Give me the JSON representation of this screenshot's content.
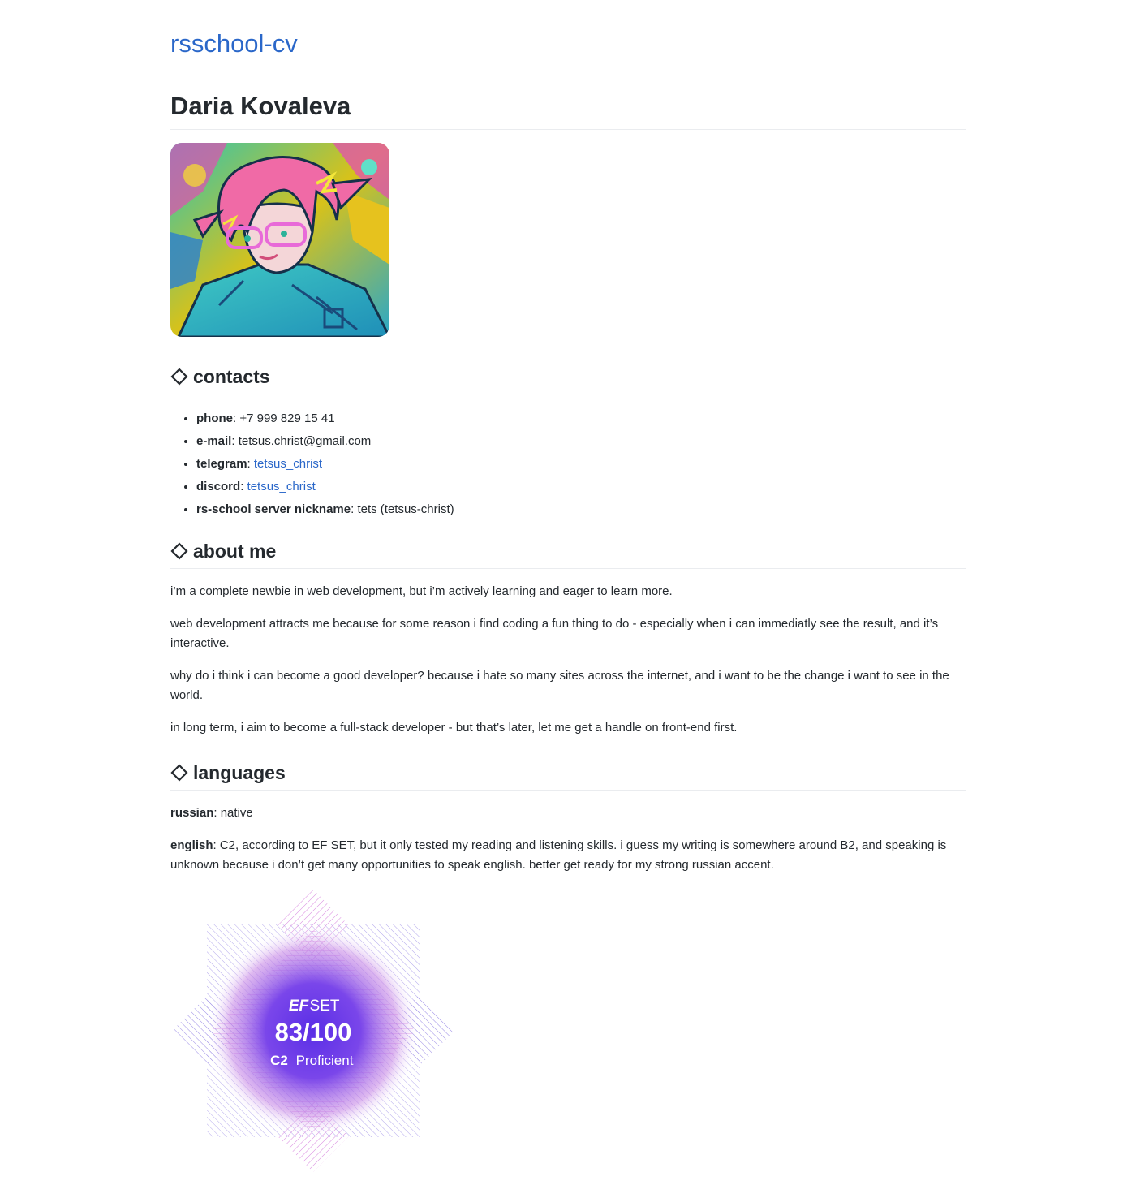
{
  "site": {
    "title": "rsschool-cv"
  },
  "profile": {
    "name": "Daria Kovaleva"
  },
  "contacts": {
    "heading": "contacts",
    "items": [
      {
        "label": "phone",
        "sep": ": ",
        "value": "+7 999 829 15 41",
        "is_link": false
      },
      {
        "label": "e-mail",
        "sep": ": ",
        "value": "tetsus.christ@gmail.com",
        "is_link": false
      },
      {
        "label": "telegram",
        "sep": ": ",
        "value": "tetsus_christ",
        "is_link": true
      },
      {
        "label": "discord",
        "sep": ": ",
        "value": "tetsus_christ",
        "is_link": true
      },
      {
        "label": "rs-school server nickname",
        "sep": ": ",
        "value": "tets (tetsus-christ)",
        "is_link": false
      }
    ]
  },
  "about": {
    "heading": "about me",
    "paragraphs": [
      "i’m a complete newbie in web development, but i’m actively learning and eager to learn more.",
      "web development attracts me because for some reason i find coding a fun thing to do - especially when i can immediatly see the result, and it’s interactive.",
      "why do i think i can become a good developer? because i hate so many sites across the internet, and i want to be the change i want to see in the world.",
      "in long term, i aim to become a full-stack developer - but that’s later, let me get a handle on front-end first."
    ]
  },
  "languages": {
    "heading": "languages",
    "items": [
      {
        "label": "russian",
        "text": ": native"
      },
      {
        "label": "english",
        "text": ": C2, according to EF SET, but it only tested my reading and listening skills. i guess my writing is somewhere around B2, and speaking is unknown because i don’t get many opportunities to speak english. better get ready for my strong russian accent."
      }
    ]
  },
  "badge": {
    "brand_ef": "EF",
    "brand_set": "SET",
    "score": "83/100",
    "level": "C2",
    "level_text": "Proficient"
  },
  "colors": {
    "link": "#2a67c9",
    "text": "#24292e",
    "divider": "#eaecef",
    "badge_purple": "#6a3de8",
    "badge_pink": "#d87be0"
  },
  "icons": {
    "section": "diamond-outline-icon"
  }
}
